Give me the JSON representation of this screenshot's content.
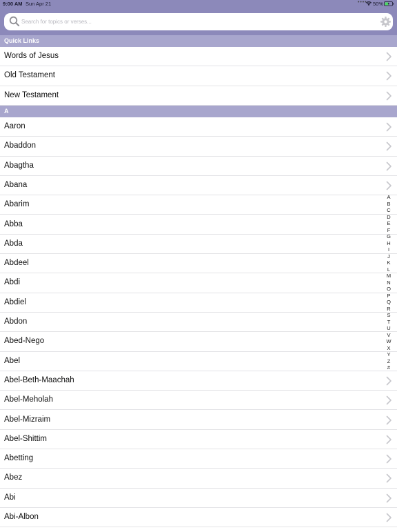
{
  "status_bar": {
    "time": "9:00 AM",
    "date": "Sun Apr 21",
    "dots": "• • • •",
    "battery": "50%"
  },
  "search": {
    "placeholder": "Search for topics or verses..."
  },
  "quick_links": {
    "header": "Quick Links",
    "items": [
      "Words of Jesus",
      "Old Testament",
      "New Testament"
    ]
  },
  "section_a": {
    "header": "A",
    "items": [
      "Aaron",
      "Abaddon",
      "Abagtha",
      "Abana",
      "Abarim",
      "Abba",
      "Abda",
      "Abdeel",
      "Abdi",
      "Abdiel",
      "Abdon",
      "Abed-Nego",
      "Abel",
      "Abel-Beth-Maachah",
      "Abel-Meholah",
      "Abel-Mizraim",
      "Abel-Shittim",
      "Abetting",
      "Abez",
      "Abi",
      "Abi-Albon"
    ]
  },
  "index_letters": [
    "A",
    "B",
    "C",
    "D",
    "E",
    "F",
    "G",
    "H",
    "I",
    "J",
    "K",
    "L",
    "M",
    "N",
    "O",
    "P",
    "Q",
    "R",
    "S",
    "T",
    "U",
    "V",
    "W",
    "X",
    "Y",
    "Z",
    "#"
  ],
  "colors": {
    "navbar": "#8c89ba",
    "section_header": "#a8a6cd",
    "battery_fill": "#4cd964"
  }
}
